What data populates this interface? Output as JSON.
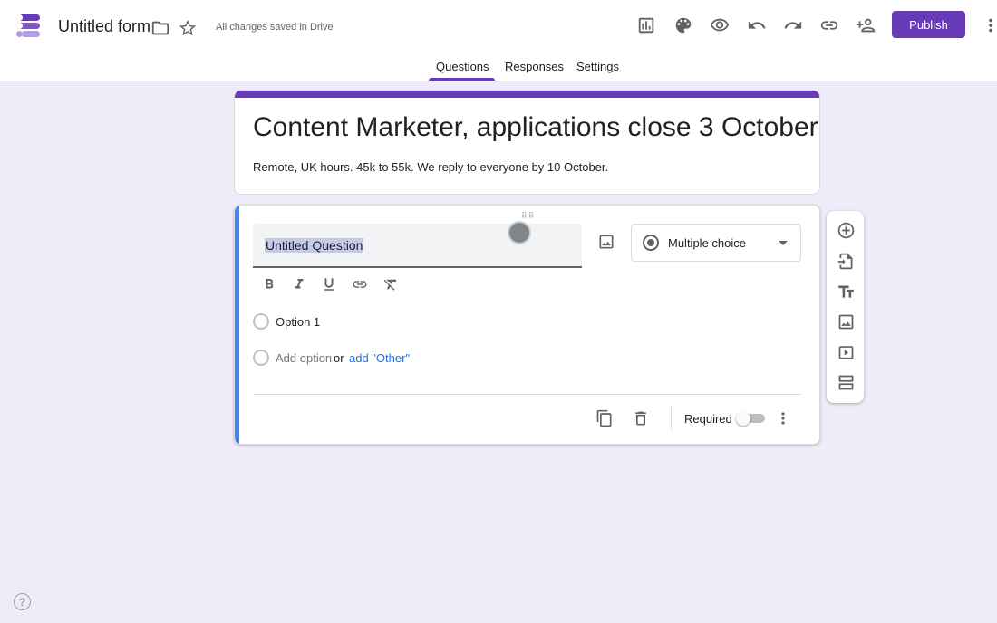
{
  "header": {
    "form_title": "Untitled form",
    "save_status": "All changes saved in Drive",
    "publish_label": "Publish",
    "icons": [
      "forms-logo-icon",
      "folder-icon",
      "star-icon",
      "addon-icon",
      "palette-icon",
      "preview-eye-icon",
      "undo-icon",
      "redo-icon",
      "link-icon",
      "add-collaborator-icon",
      "more-vert-icon"
    ]
  },
  "tabs": [
    {
      "label": "Questions",
      "active": true
    },
    {
      "label": "Responses",
      "active": false
    },
    {
      "label": "Settings",
      "active": false
    }
  ],
  "form": {
    "title": "Content Marketer, applications close 3 October",
    "description": "Remote, UK hours. 45k to 55k. We reply to everyone by 10 October."
  },
  "question": {
    "title": "Untitled Question",
    "type": "Multiple choice",
    "options": [
      "Option 1"
    ],
    "add_option": "Add option",
    "or": "or",
    "add_other": "add \"Other\"",
    "required_label": "Required",
    "required": false
  },
  "colors": {
    "accent": "#673ab7",
    "background": "#f0ebf8",
    "active_question_bar": "#4285f4",
    "link": "#1a73e8"
  },
  "help_label": "?"
}
